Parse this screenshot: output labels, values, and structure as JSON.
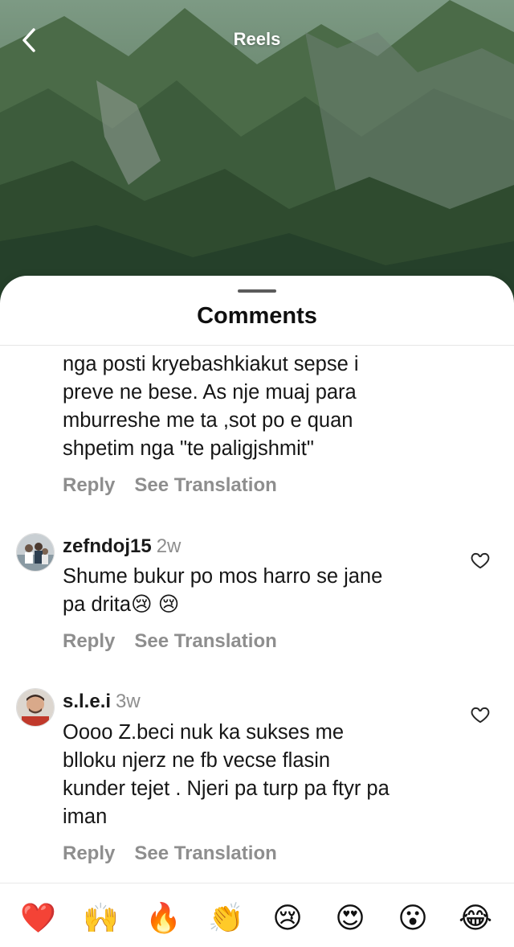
{
  "header": {
    "title": "Reels"
  },
  "sheet": {
    "title": "Comments"
  },
  "comments": [
    {
      "lines": [
        "nga posti kryebashkiakut sepse i",
        "preve ne bese. As nje muaj para",
        "mburreshe me ta ,sot po e quan",
        "shpetim nga \"te paligjshmit\""
      ],
      "reply_label": "Reply",
      "translate_label": "See Translation"
    },
    {
      "username": "zefndoj15",
      "time": "2w",
      "lines": [
        "Shume  bukur  po mos harro  se jane",
        "pa drita😢 😢"
      ],
      "reply_label": "Reply",
      "translate_label": "See Translation"
    },
    {
      "username": "s.l.e.i",
      "time": "3w",
      "lines": [
        "Oooo Z.beci nuk ka sukses me",
        "blloku njerz ne fb vecse flasin",
        "kunder tejet . Njeri pa turp pa ftyr pa",
        "iman"
      ],
      "reply_label": "Reply",
      "translate_label": "See Translation"
    }
  ],
  "emoji_bar": [
    "❤️",
    "🙌",
    "🔥",
    "👏",
    "😢",
    "😍",
    "😮",
    "😂"
  ],
  "colors": {
    "secondary_text": "#8e8e8e",
    "sheet_bg": "#ffffff",
    "heart_outline": "#262626"
  },
  "icons": {
    "back": "chevron-left-icon",
    "like": "heart-outline-icon"
  }
}
